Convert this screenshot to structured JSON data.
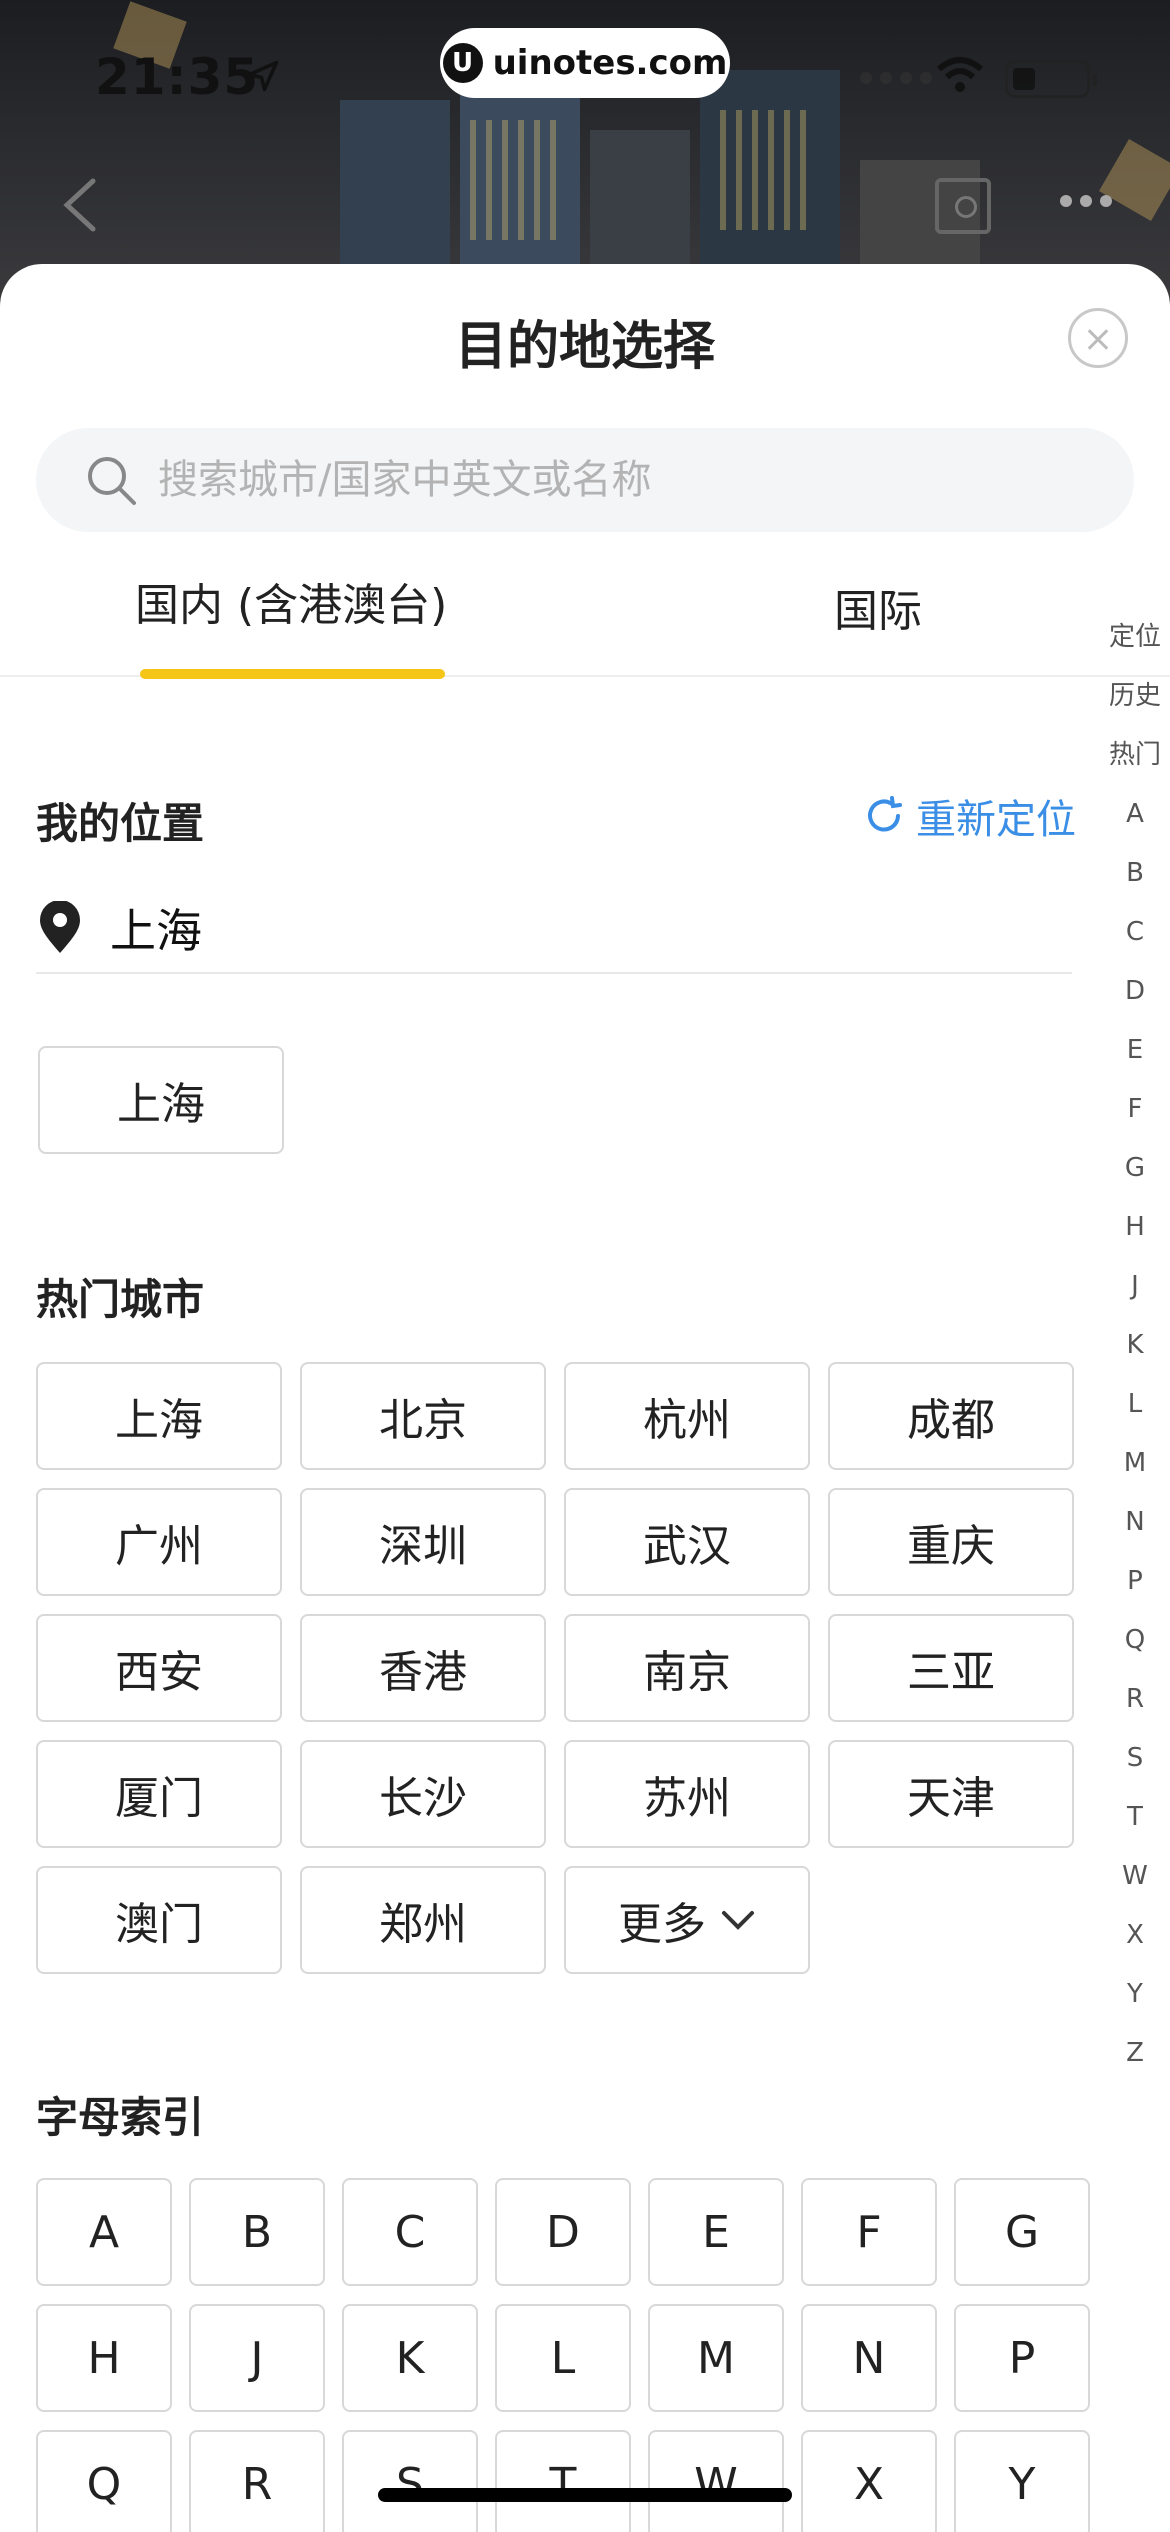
{
  "status_bar": {
    "time": "21:35"
  },
  "watermark": {
    "logo": "U",
    "text": "uinotes.com"
  },
  "sheet": {
    "title": "目的地选择"
  },
  "search": {
    "placeholder": "搜索城市/国家中英文或名称"
  },
  "tabs": [
    {
      "label": "国内 (含港澳台)",
      "active": true
    },
    {
      "label": "国际",
      "active": false
    }
  ],
  "my_location": {
    "heading": "我的位置",
    "relocate_label": "重新定位",
    "current_city": "上海",
    "chip": "上海"
  },
  "hot_cities": {
    "heading": "热门城市",
    "items": [
      "上海",
      "北京",
      "杭州",
      "成都",
      "广州",
      "深圳",
      "武汉",
      "重庆",
      "西安",
      "香港",
      "南京",
      "三亚",
      "厦门",
      "长沙",
      "苏州",
      "天津",
      "澳门",
      "郑州"
    ],
    "more_label": "更多"
  },
  "letter_index": {
    "heading": "字母索引",
    "letters": [
      "A",
      "B",
      "C",
      "D",
      "E",
      "F",
      "G",
      "H",
      "J",
      "K",
      "L",
      "M",
      "N",
      "P",
      "Q",
      "R",
      "S",
      "T",
      "W",
      "X",
      "Y"
    ]
  },
  "side_index": [
    "定位",
    "历史",
    "热门",
    "A",
    "B",
    "C",
    "D",
    "E",
    "F",
    "G",
    "H",
    "J",
    "K",
    "L",
    "M",
    "N",
    "P",
    "Q",
    "R",
    "S",
    "T",
    "W",
    "X",
    "Y",
    "Z"
  ],
  "colors": {
    "accent": "#f5c518",
    "link": "#3a8ee6"
  }
}
